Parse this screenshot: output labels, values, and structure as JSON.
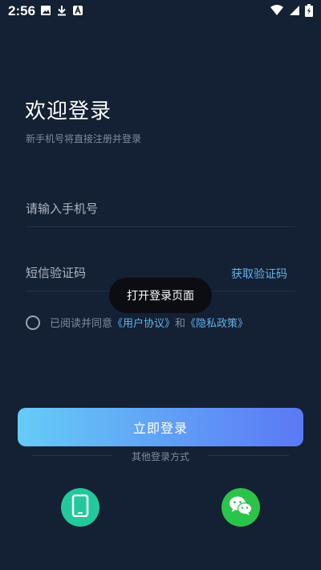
{
  "status_bar": {
    "time": "2:56"
  },
  "login": {
    "title": "欢迎登录",
    "subtitle": "新手机号将直接注册并登录",
    "phone_placeholder": "请输入手机号",
    "sms_placeholder": "短信验证码",
    "get_code_label": "获取验证码",
    "agree_prefix": "已阅读并同意",
    "user_agreement": "《用户协议》",
    "and_text": "和",
    "privacy_policy": "《隐私政策》",
    "login_button": "立即登录",
    "other_methods": "其他登录方式"
  },
  "toast": {
    "message": "打开登录页面"
  },
  "colors": {
    "background": "#142033",
    "accent_link": "#5fb4ec",
    "button_gradient_start": "#66ccf7",
    "button_gradient_end": "#5b78f5",
    "phone_login": "#22c99a",
    "wechat_login": "#2bc44a"
  },
  "icons": {
    "phone_login": "mobile-phone-icon",
    "wechat_login": "wechat-icon"
  }
}
